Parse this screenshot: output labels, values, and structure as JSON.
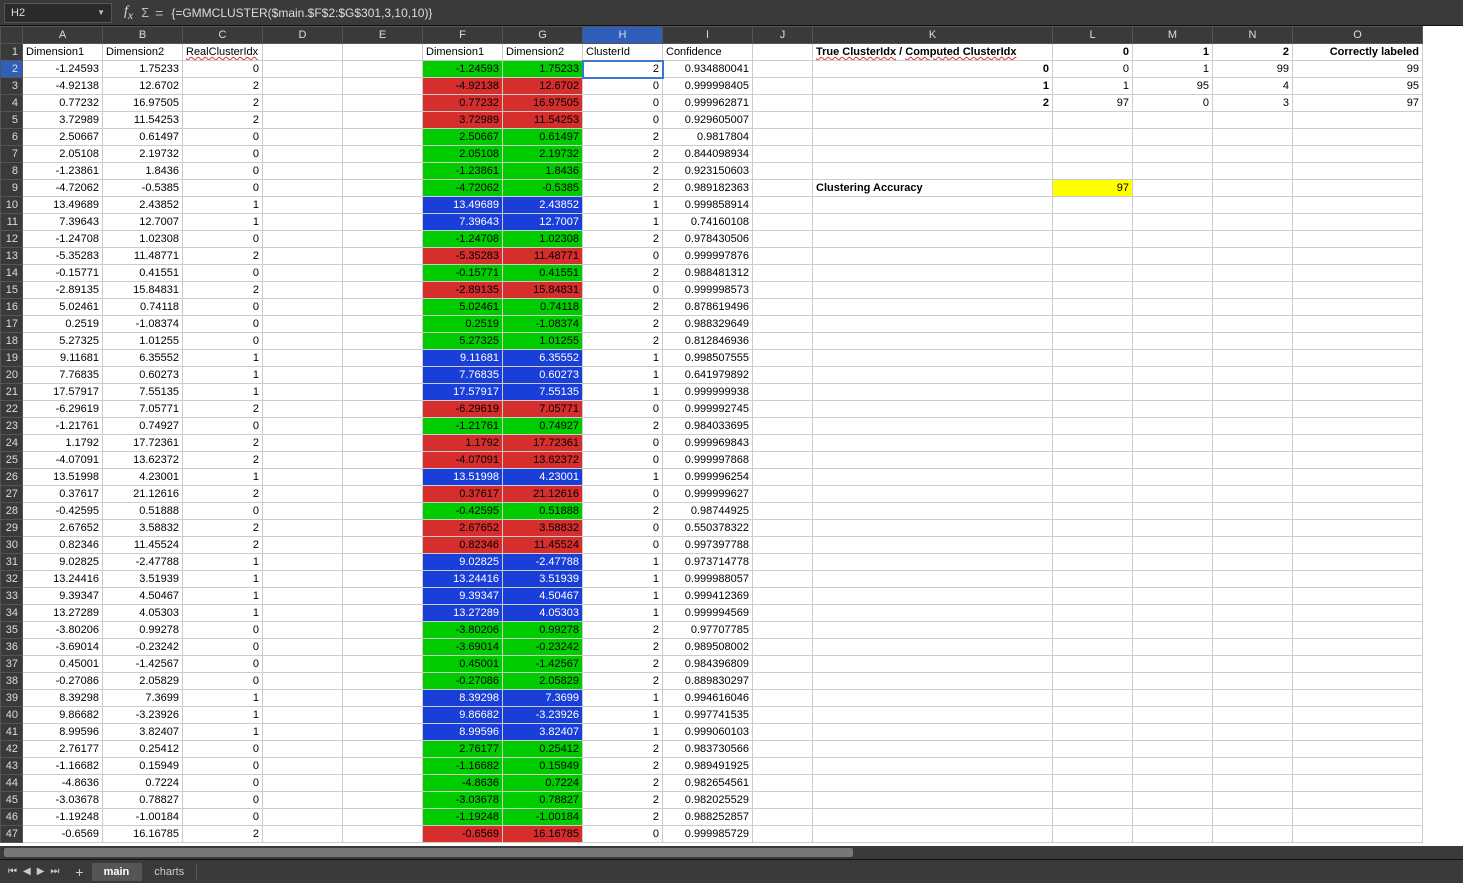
{
  "formula_bar": {
    "cell_ref": "H2",
    "formula": "{=GMMCLUSTER($main.$F$2:$G$301,3,10,10)}"
  },
  "active_cell": {
    "col": "H",
    "row": 2
  },
  "columns": [
    "A",
    "B",
    "C",
    "D",
    "E",
    "F",
    "G",
    "H",
    "I",
    "J",
    "K",
    "L",
    "M",
    "N",
    "O"
  ],
  "row_count": 47,
  "headers": {
    "A": "Dimension1",
    "B": "Dimension2",
    "C": "RealClusterIdx",
    "F": "Dimension1",
    "G": "Dimension2",
    "H": "ClusterId",
    "I": "Confidence"
  },
  "rows": [
    {
      "A": "-1.24593",
      "B": "1.75233",
      "C": "0",
      "F": "-1.24593",
      "G": "1.75233",
      "H": "2",
      "I": "0.934880041",
      "clr": "green"
    },
    {
      "A": "-4.92138",
      "B": "12.6702",
      "C": "2",
      "F": "-4.92138",
      "G": "12.6702",
      "H": "0",
      "I": "0.999998405",
      "clr": "red"
    },
    {
      "A": "0.77232",
      "B": "16.97505",
      "C": "2",
      "F": "0.77232",
      "G": "16.97505",
      "H": "0",
      "I": "0.999962871",
      "clr": "red"
    },
    {
      "A": "3.72989",
      "B": "11.54253",
      "C": "2",
      "F": "3.72989",
      "G": "11.54253",
      "H": "0",
      "I": "0.929605007",
      "clr": "red"
    },
    {
      "A": "2.50667",
      "B": "0.61497",
      "C": "0",
      "F": "2.50667",
      "G": "0.61497",
      "H": "2",
      "I": "0.9817804",
      "clr": "green"
    },
    {
      "A": "2.05108",
      "B": "2.19732",
      "C": "0",
      "F": "2.05108",
      "G": "2.19732",
      "H": "2",
      "I": "0.844098934",
      "clr": "green"
    },
    {
      "A": "-1.23861",
      "B": "1.8436",
      "C": "0",
      "F": "-1.23861",
      "G": "1.8436",
      "H": "2",
      "I": "0.923150603",
      "clr": "green"
    },
    {
      "A": "-4.72062",
      "B": "-0.5385",
      "C": "0",
      "F": "-4.72062",
      "G": "-0.5385",
      "H": "2",
      "I": "0.989182363",
      "clr": "green"
    },
    {
      "A": "13.49689",
      "B": "2.43852",
      "C": "1",
      "F": "13.49689",
      "G": "2.43852",
      "H": "1",
      "I": "0.999858914",
      "clr": "blue"
    },
    {
      "A": "7.39643",
      "B": "12.7007",
      "C": "1",
      "F": "7.39643",
      "G": "12.7007",
      "H": "1",
      "I": "0.74160108",
      "clr": "blue"
    },
    {
      "A": "-1.24708",
      "B": "1.02308",
      "C": "0",
      "F": "-1.24708",
      "G": "1.02308",
      "H": "2",
      "I": "0.978430506",
      "clr": "green"
    },
    {
      "A": "-5.35283",
      "B": "11.48771",
      "C": "2",
      "F": "-5.35283",
      "G": "11.48771",
      "H": "0",
      "I": "0.999997876",
      "clr": "red"
    },
    {
      "A": "-0.15771",
      "B": "0.41551",
      "C": "0",
      "F": "-0.15771",
      "G": "0.41551",
      "H": "2",
      "I": "0.988481312",
      "clr": "green"
    },
    {
      "A": "-2.89135",
      "B": "15.84831",
      "C": "2",
      "F": "-2.89135",
      "G": "15.84831",
      "H": "0",
      "I": "0.999998573",
      "clr": "red"
    },
    {
      "A": "5.02461",
      "B": "0.74118",
      "C": "0",
      "F": "5.02461",
      "G": "0.74118",
      "H": "2",
      "I": "0.878619496",
      "clr": "green"
    },
    {
      "A": "0.2519",
      "B": "-1.08374",
      "C": "0",
      "F": "0.2519",
      "G": "-1.08374",
      "H": "2",
      "I": "0.988329649",
      "clr": "green"
    },
    {
      "A": "5.27325",
      "B": "1.01255",
      "C": "0",
      "F": "5.27325",
      "G": "1.01255",
      "H": "2",
      "I": "0.812846936",
      "clr": "green"
    },
    {
      "A": "9.11681",
      "B": "6.35552",
      "C": "1",
      "F": "9.11681",
      "G": "6.35552",
      "H": "1",
      "I": "0.998507555",
      "clr": "blue"
    },
    {
      "A": "7.76835",
      "B": "0.60273",
      "C": "1",
      "F": "7.76835",
      "G": "0.60273",
      "H": "1",
      "I": "0.641979892",
      "clr": "blue"
    },
    {
      "A": "17.57917",
      "B": "7.55135",
      "C": "1",
      "F": "17.57917",
      "G": "7.55135",
      "H": "1",
      "I": "0.999999938",
      "clr": "blue"
    },
    {
      "A": "-6.29619",
      "B": "7.05771",
      "C": "2",
      "F": "-6.29619",
      "G": "7.05771",
      "H": "0",
      "I": "0.999992745",
      "clr": "red"
    },
    {
      "A": "-1.21761",
      "B": "0.74927",
      "C": "0",
      "F": "-1.21761",
      "G": "0.74927",
      "H": "2",
      "I": "0.984033695",
      "clr": "green"
    },
    {
      "A": "1.1792",
      "B": "17.72361",
      "C": "2",
      "F": "1.1792",
      "G": "17.72361",
      "H": "0",
      "I": "0.999969843",
      "clr": "red"
    },
    {
      "A": "-4.07091",
      "B": "13.62372",
      "C": "2",
      "F": "-4.07091",
      "G": "13.62372",
      "H": "0",
      "I": "0.999997868",
      "clr": "red"
    },
    {
      "A": "13.51998",
      "B": "4.23001",
      "C": "1",
      "F": "13.51998",
      "G": "4.23001",
      "H": "1",
      "I": "0.999996254",
      "clr": "blue"
    },
    {
      "A": "0.37617",
      "B": "21.12616",
      "C": "2",
      "F": "0.37617",
      "G": "21.12616",
      "H": "0",
      "I": "0.999999627",
      "clr": "red"
    },
    {
      "A": "-0.42595",
      "B": "0.51888",
      "C": "0",
      "F": "-0.42595",
      "G": "0.51888",
      "H": "2",
      "I": "0.98744925",
      "clr": "green"
    },
    {
      "A": "2.67652",
      "B": "3.58832",
      "C": "2",
      "F": "2.67652",
      "G": "3.58832",
      "H": "0",
      "I": "0.550378322",
      "clr": "red"
    },
    {
      "A": "0.82346",
      "B": "11.45524",
      "C": "2",
      "F": "0.82346",
      "G": "11.45524",
      "H": "0",
      "I": "0.997397788",
      "clr": "red"
    },
    {
      "A": "9.02825",
      "B": "-2.47788",
      "C": "1",
      "F": "9.02825",
      "G": "-2.47788",
      "H": "1",
      "I": "0.973714778",
      "clr": "blue"
    },
    {
      "A": "13.24416",
      "B": "3.51939",
      "C": "1",
      "F": "13.24416",
      "G": "3.51939",
      "H": "1",
      "I": "0.999988057",
      "clr": "blue"
    },
    {
      "A": "9.39347",
      "B": "4.50467",
      "C": "1",
      "F": "9.39347",
      "G": "4.50467",
      "H": "1",
      "I": "0.999412369",
      "clr": "blue"
    },
    {
      "A": "13.27289",
      "B": "4.05303",
      "C": "1",
      "F": "13.27289",
      "G": "4.05303",
      "H": "1",
      "I": "0.999994569",
      "clr": "blue"
    },
    {
      "A": "-3.80206",
      "B": "0.99278",
      "C": "0",
      "F": "-3.80206",
      "G": "0.99278",
      "H": "2",
      "I": "0.97707785",
      "clr": "green"
    },
    {
      "A": "-3.69014",
      "B": "-0.23242",
      "C": "0",
      "F": "-3.69014",
      "G": "-0.23242",
      "H": "2",
      "I": "0.989508002",
      "clr": "green"
    },
    {
      "A": "0.45001",
      "B": "-1.42567",
      "C": "0",
      "F": "0.45001",
      "G": "-1.42567",
      "H": "2",
      "I": "0.984396809",
      "clr": "green"
    },
    {
      "A": "-0.27086",
      "B": "2.05829",
      "C": "0",
      "F": "-0.27086",
      "G": "2.05829",
      "H": "2",
      "I": "0.889830297",
      "clr": "green"
    },
    {
      "A": "8.39298",
      "B": "7.3699",
      "C": "1",
      "F": "8.39298",
      "G": "7.3699",
      "H": "1",
      "I": "0.994616046",
      "clr": "blue"
    },
    {
      "A": "9.86682",
      "B": "-3.23926",
      "C": "1",
      "F": "9.86682",
      "G": "-3.23926",
      "H": "1",
      "I": "0.997741535",
      "clr": "blue"
    },
    {
      "A": "8.99596",
      "B": "3.82407",
      "C": "1",
      "F": "8.99596",
      "G": "3.82407",
      "H": "1",
      "I": "0.999060103",
      "clr": "blue"
    },
    {
      "A": "2.76177",
      "B": "0.25412",
      "C": "0",
      "F": "2.76177",
      "G": "0.25412",
      "H": "2",
      "I": "0.983730566",
      "clr": "green"
    },
    {
      "A": "-1.16682",
      "B": "0.15949",
      "C": "0",
      "F": "-1.16682",
      "G": "0.15949",
      "H": "2",
      "I": "0.989491925",
      "clr": "green"
    },
    {
      "A": "-4.8636",
      "B": "0.7224",
      "C": "0",
      "F": "-4.8636",
      "G": "0.7224",
      "H": "2",
      "I": "0.982654561",
      "clr": "green"
    },
    {
      "A": "-3.03678",
      "B": "0.78827",
      "C": "0",
      "F": "-3.03678",
      "G": "0.78827",
      "H": "2",
      "I": "0.982025529",
      "clr": "green"
    },
    {
      "A": "-1.19248",
      "B": "-1.00184",
      "C": "0",
      "F": "-1.19248",
      "G": "-1.00184",
      "H": "2",
      "I": "0.988252857",
      "clr": "green"
    },
    {
      "A": "-0.6569",
      "B": "16.16785",
      "C": "2",
      "F": "-0.6569",
      "G": "16.16785",
      "H": "0",
      "I": "0.999985729",
      "clr": "red"
    }
  ],
  "side": {
    "title_a": "True ClusterIdx",
    "title_b": "Computed ClusterIdx",
    "sep": " / ",
    "col_headers": [
      "0",
      "1",
      "2"
    ],
    "correct_label": "Correctly labeled",
    "matrix": [
      {
        "r": "0",
        "v": [
          "0",
          "1",
          "99"
        ],
        "c": "99"
      },
      {
        "r": "1",
        "v": [
          "1",
          "95",
          "4"
        ],
        "c": "95"
      },
      {
        "r": "2",
        "v": [
          "97",
          "0",
          "3"
        ],
        "c": "97"
      }
    ],
    "accuracy_label": "Clustering Accuracy",
    "accuracy_value": "97"
  },
  "tabs": {
    "sheets": [
      "main",
      "charts"
    ],
    "active": 0
  }
}
